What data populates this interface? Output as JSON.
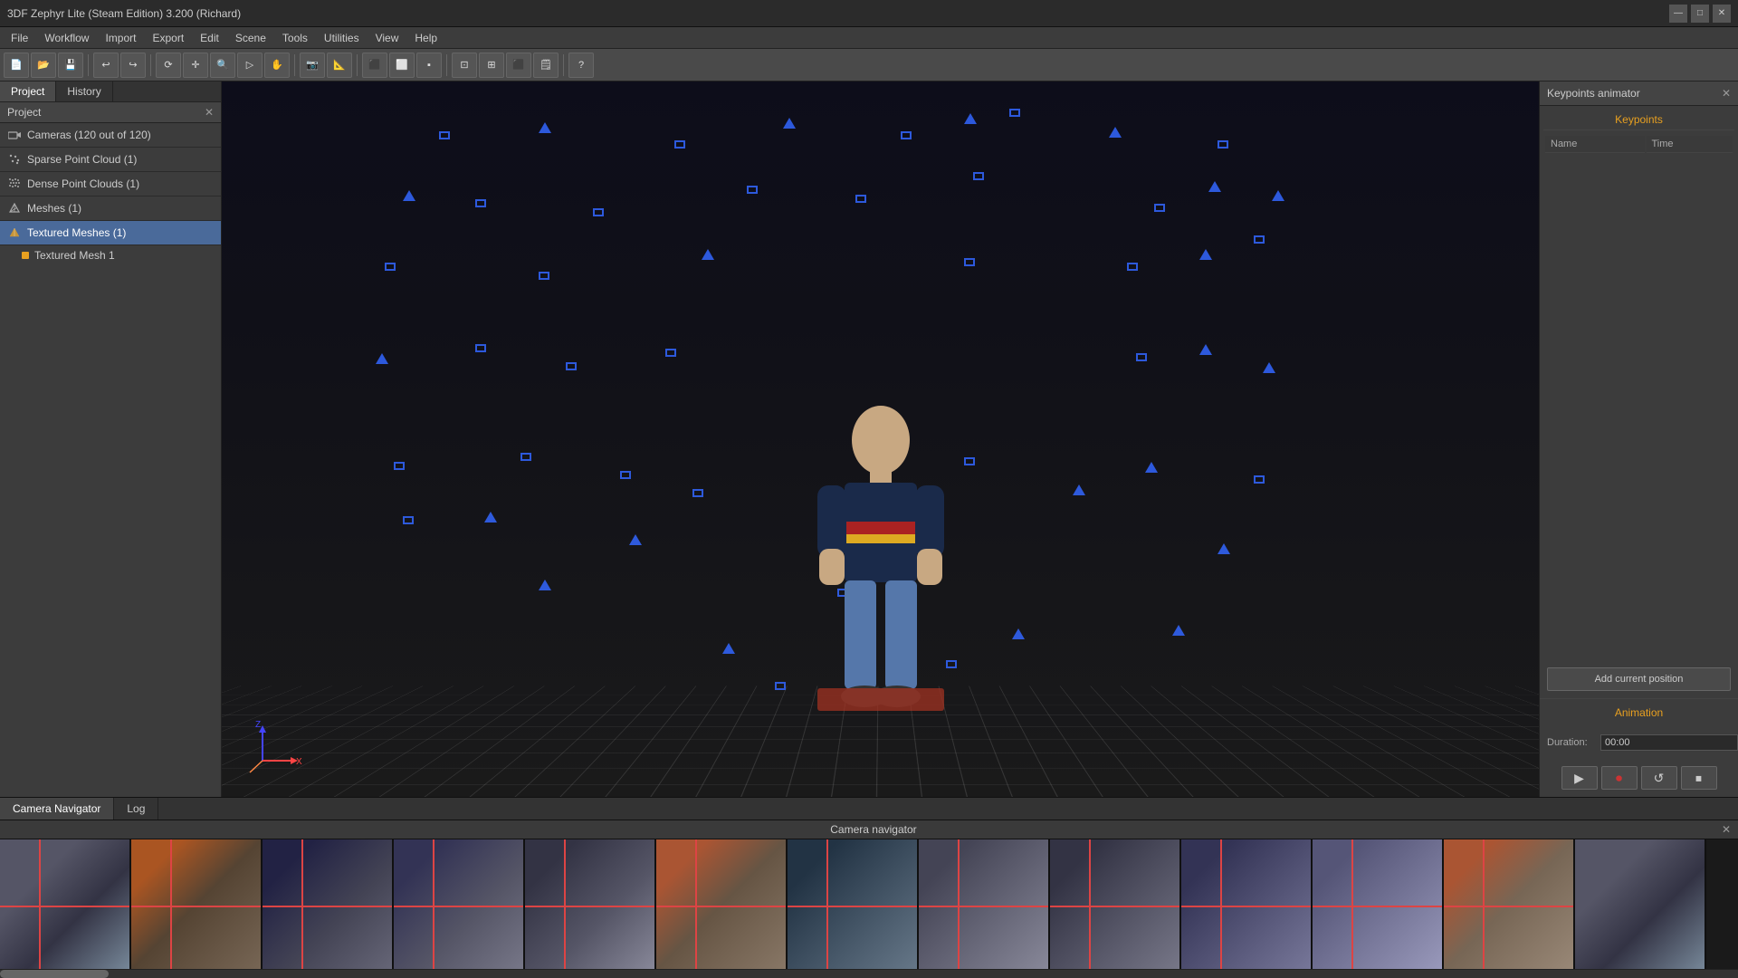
{
  "titlebar": {
    "title": "3DF Zephyr Lite (Steam Edition) 3.200 (Richard)",
    "minimize": "—",
    "maximize": "□",
    "close": "✕"
  },
  "menubar": {
    "items": [
      "File",
      "Workflow",
      "Import",
      "Export",
      "Edit",
      "Scene",
      "Tools",
      "Utilities",
      "View",
      "Help"
    ]
  },
  "left_panel": {
    "tabs": [
      "Project",
      "History"
    ],
    "active_tab": "Project",
    "header": "Project",
    "tree": [
      {
        "label": "Cameras (120 out of 120)",
        "icon": "camera",
        "selected": false
      },
      {
        "label": "Sparse Point Cloud (1)",
        "icon": "sparse",
        "selected": false
      },
      {
        "label": "Dense Point Clouds (1)",
        "icon": "dense",
        "selected": false
      },
      {
        "label": "Meshes (1)",
        "icon": "mesh",
        "selected": false
      },
      {
        "label": "Textured Meshes (1)",
        "icon": "textured",
        "selected": true
      }
    ],
    "sub_items": [
      {
        "label": "Textured Mesh 1",
        "color": "#e8a020"
      }
    ]
  },
  "right_panel": {
    "title": "Keypoints animator",
    "section_label": "Keypoints",
    "columns": [
      "Name",
      "Time"
    ],
    "add_button": "Add current position",
    "animation_label": "Animation",
    "duration_label": "Duration:",
    "duration_value": "00:00"
  },
  "bottom_panel": {
    "tabs": [
      "Camera Navigator",
      "Log"
    ],
    "active_tab": "Camera Navigator",
    "nav_title": "Camera navigator"
  },
  "viewport": {
    "axes": [
      "Z",
      "X"
    ]
  }
}
